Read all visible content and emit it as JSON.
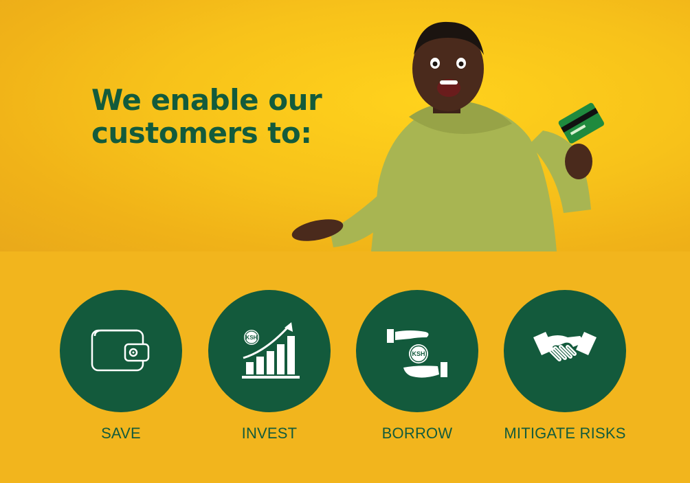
{
  "hero": {
    "headline_line1": "We enable our",
    "headline_line2": "customers to:"
  },
  "features": [
    {
      "label": "SAVE",
      "icon": "wallet-icon"
    },
    {
      "label": "INVEST",
      "icon": "growth-chart-icon",
      "badge": "KSH"
    },
    {
      "label": "BORROW",
      "icon": "hands-coin-icon",
      "badge": "KSH"
    },
    {
      "label": "MITIGATE RISKS",
      "icon": "handshake-icon"
    }
  ],
  "colors": {
    "brand_green": "#135b3c",
    "background_yellow": "#f2b51d"
  }
}
